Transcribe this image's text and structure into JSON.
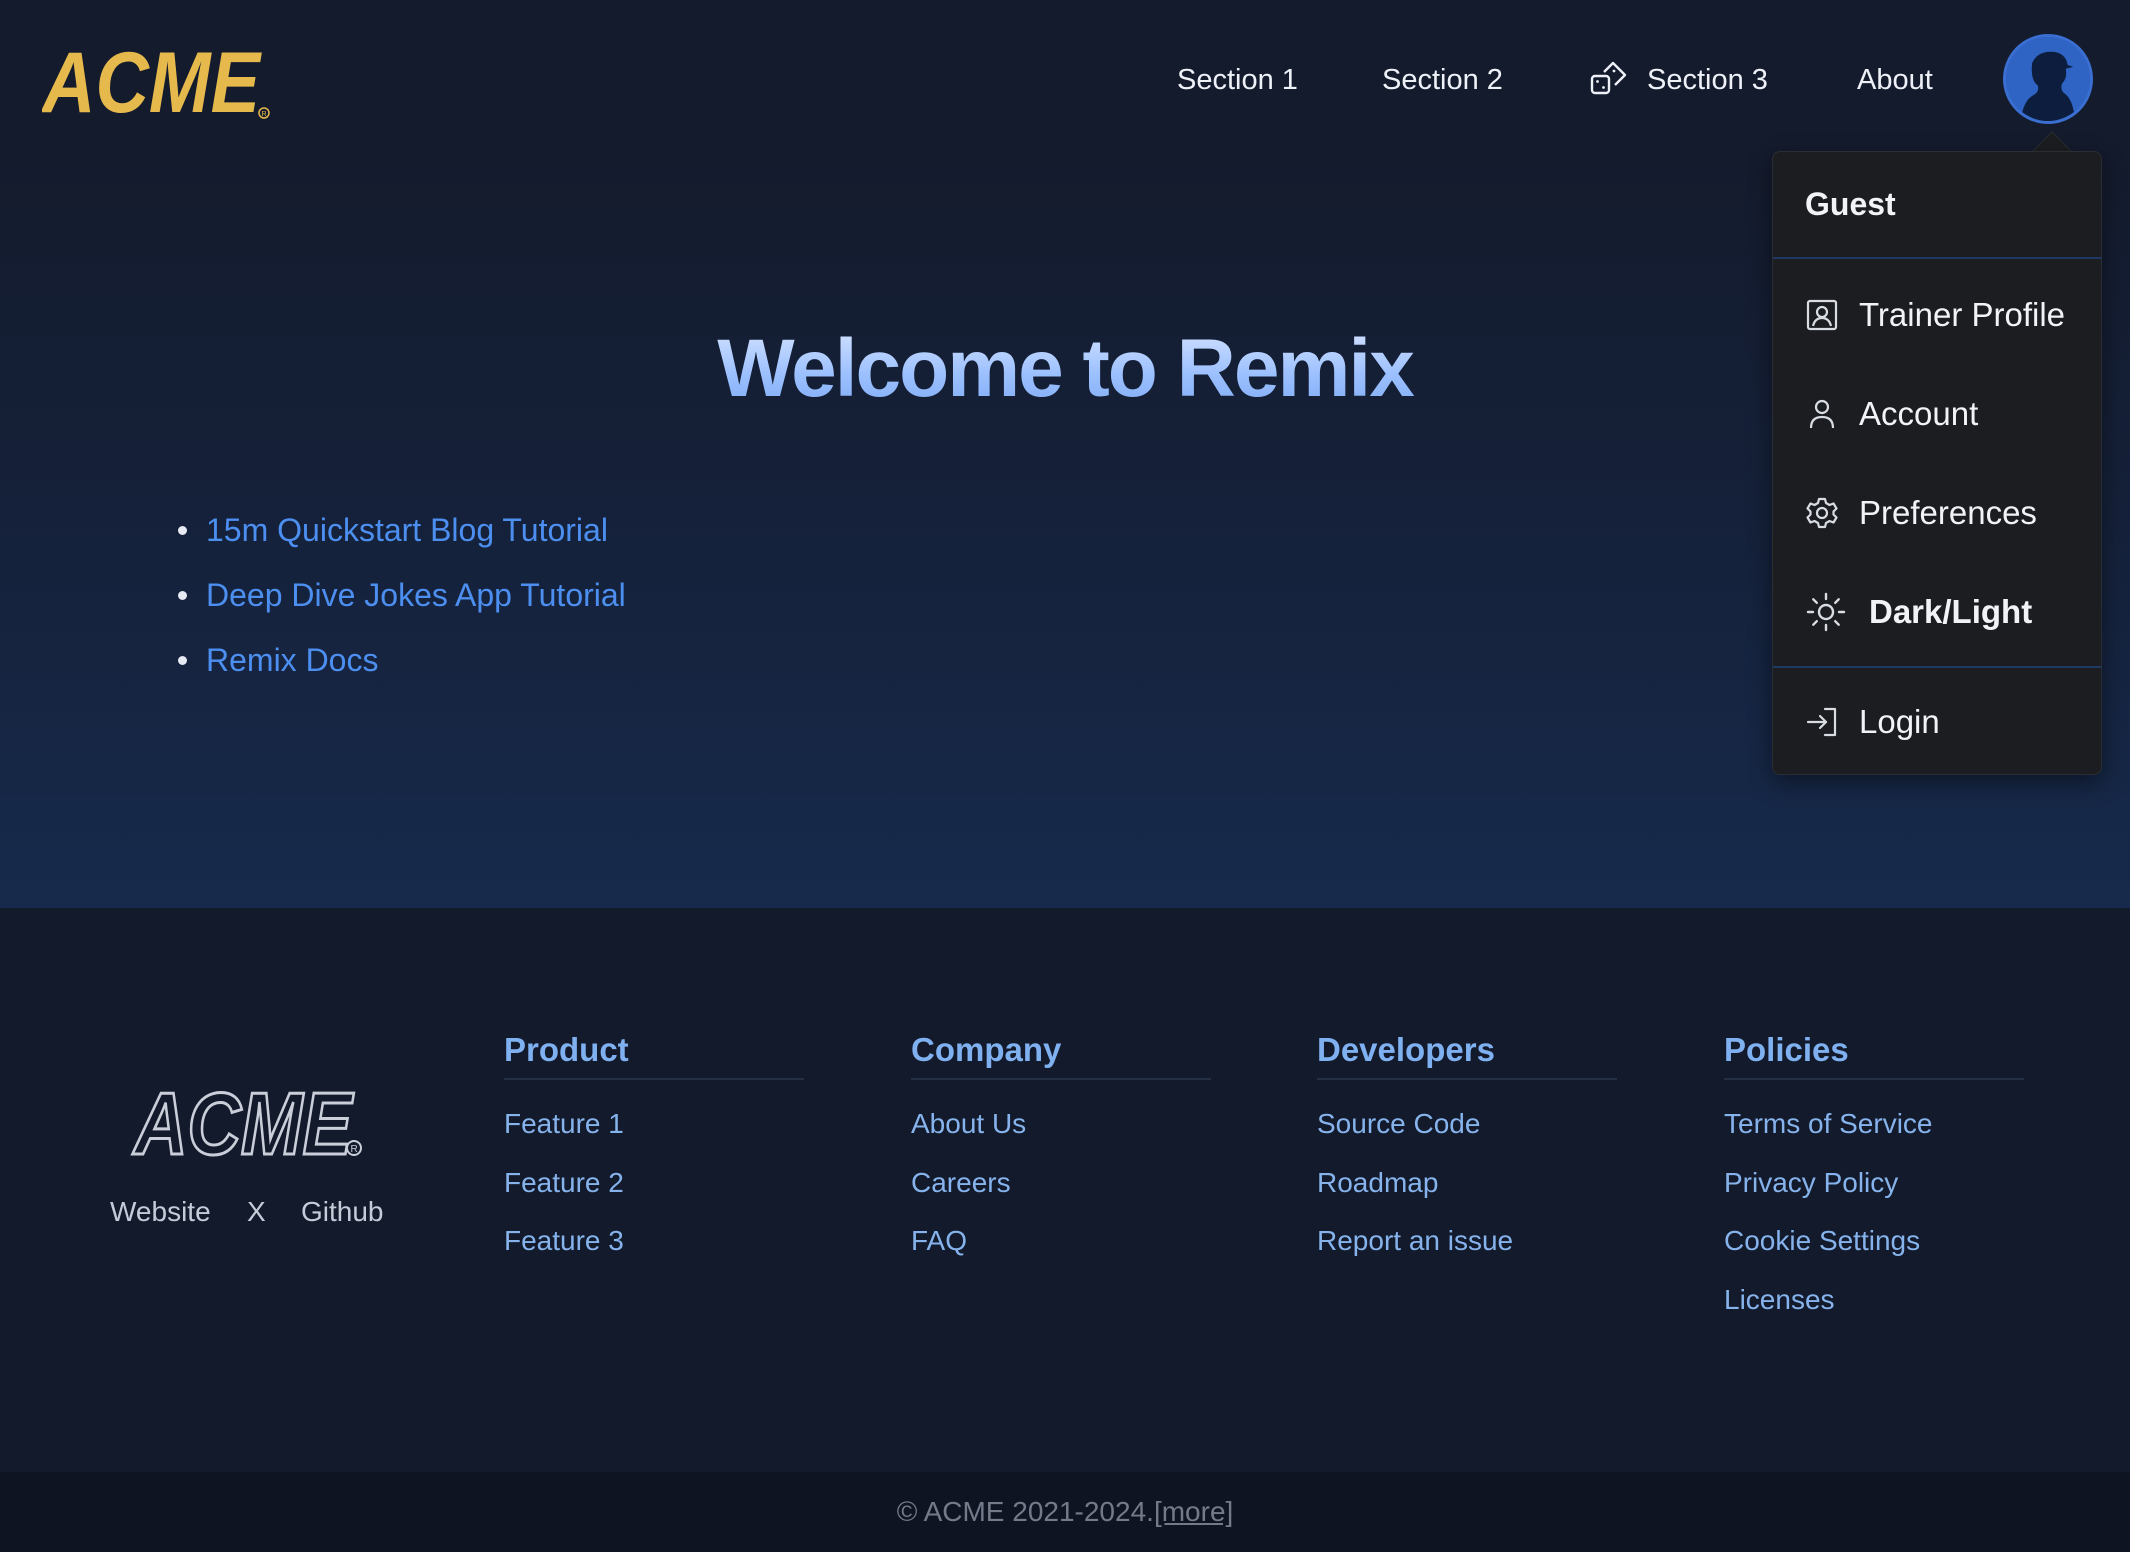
{
  "header": {
    "logo_text": "ACME",
    "nav": {
      "section1": "Section 1",
      "section2": "Section 2",
      "section3": "Section 3",
      "about": "About"
    }
  },
  "hero": {
    "title": "Welcome to Remix",
    "links": [
      "15m Quickstart Blog Tutorial",
      "Deep Dive Jokes App Tutorial",
      "Remix Docs"
    ]
  },
  "user_menu": {
    "username": "Guest",
    "items": {
      "trainer_profile": "Trainer Profile",
      "account": "Account",
      "preferences": "Preferences",
      "dark_light": "Dark/Light",
      "login": "Login"
    }
  },
  "footer": {
    "logo_text": "ACME",
    "social": {
      "website": "Website",
      "x": "X",
      "github": "Github"
    },
    "columns": [
      {
        "title": "Product",
        "items": [
          "Feature 1",
          "Feature 2",
          "Feature 3"
        ]
      },
      {
        "title": "Company",
        "items": [
          "About Us",
          "Careers",
          "FAQ"
        ]
      },
      {
        "title": "Developers",
        "items": [
          "Source Code",
          "Roadmap",
          "Report an issue"
        ]
      },
      {
        "title": "Policies",
        "items": [
          "Terms of Service",
          "Privacy Policy",
          "Cookie Settings",
          "Licenses"
        ]
      }
    ],
    "copyright": "© ACME 2021-2024.",
    "more_link": "[more]"
  },
  "colors": {
    "background": "#131a2c",
    "logo_gold": "#e5b94c",
    "link_blue": "#4c8ff0",
    "footer_blue": "#7fb0f0",
    "menu_bg": "#1c1d20"
  },
  "icons": {
    "section3": "dice-icon",
    "trainer_profile": "portrait-icon",
    "account": "user-icon",
    "preferences": "gear-icon",
    "dark_light": "sun-icon",
    "login": "login-icon"
  }
}
